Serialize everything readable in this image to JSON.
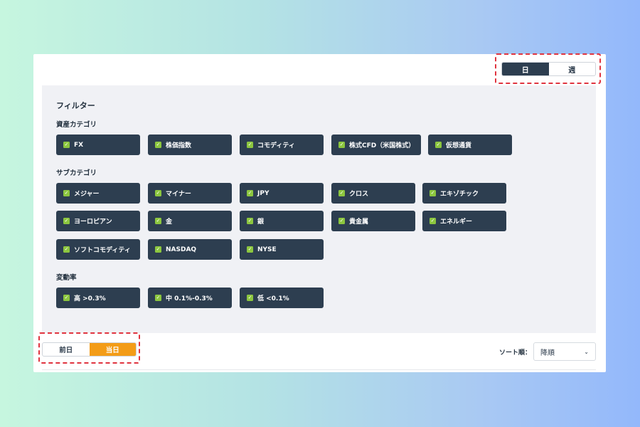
{
  "period_toggle": {
    "options": [
      "日",
      "週"
    ],
    "selected": "日"
  },
  "filter": {
    "title": "フィルター",
    "sections": [
      {
        "label": "資産カテゴリ",
        "items": [
          "FX",
          "株価指数",
          "コモディティ",
          "株式CFD（米国株式）",
          "仮想通貨"
        ]
      },
      {
        "label": "サブカテゴリ",
        "items": [
          "メジャー",
          "マイナー",
          "JPY",
          "クロス",
          "エキゾチック",
          "ヨーロピアン",
          "金",
          "銀",
          "貴金属",
          "エネルギー",
          "ソフトコモディティ",
          "NASDAQ",
          "NYSE"
        ]
      },
      {
        "label": "変動率",
        "items": [
          "高 >0.3%",
          "中 0.1%-0.3%",
          "低 <0.1%"
        ]
      }
    ],
    "all_checked": true
  },
  "day_toggle": {
    "options": [
      "前日",
      "当日"
    ],
    "selected": "当日"
  },
  "sort": {
    "label": "ソート順：",
    "value": "降順"
  },
  "colors": {
    "chip_bg": "#2d3e50",
    "check_green": "#8cc63f",
    "accent_orange": "#f39c17",
    "highlight_red": "#e0343f"
  },
  "icons": {
    "check": "checkbox-checked-icon",
    "dropdown": "chevron-down-icon"
  }
}
